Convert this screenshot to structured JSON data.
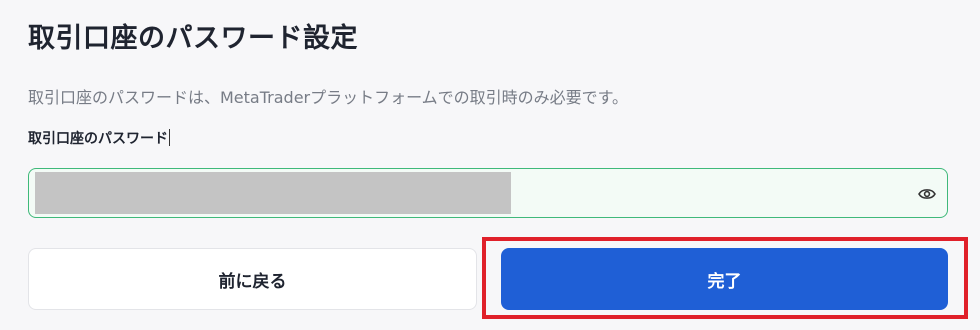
{
  "page": {
    "title": "取引口座のパスワード設定",
    "description": "取引口座のパスワードは、MetaTraderプラットフォームでの取引時のみ必要です。"
  },
  "password_field": {
    "label": "取引口座のパスワード",
    "value_masked": true,
    "toggle_icon": "eye-icon"
  },
  "buttons": {
    "back_label": "前に戻る",
    "done_label": "完了"
  },
  "colors": {
    "primary": "#1f5fd6",
    "field_border": "#3fb97a",
    "highlight": "#e0202a"
  }
}
